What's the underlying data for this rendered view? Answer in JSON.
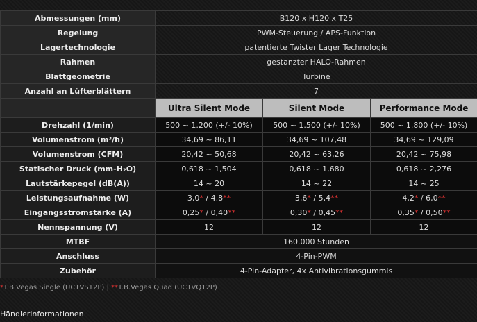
{
  "general": [
    {
      "label": "Abmessungen (mm)",
      "value": "B120 x H120 x T25"
    },
    {
      "label": "Regelung",
      "value": "PWM-Steuerung / APS-Funktion"
    },
    {
      "label": "Lagertechnologie",
      "value": "patentierte Twister Lager Technologie"
    },
    {
      "label": "Rahmen",
      "value": "gestanzter HALO-Rahmen"
    },
    {
      "label": "Blattgeometrie",
      "value": "Turbine"
    },
    {
      "label": "Anzahl an Lüfterblättern",
      "value": "7"
    }
  ],
  "modes": [
    "Ultra Silent Mode",
    "Silent Mode",
    "Performance Mode"
  ],
  "rows": [
    {
      "label": "Drehzahl (1/min)",
      "values": [
        "500 ~ 1.200 (+/- 10%)",
        "500 ~ 1.500 (+/- 10%)",
        "500 ~ 1.800 (+/- 10%)"
      ]
    },
    {
      "label": "Volumenstrom (m³/h)",
      "values": [
        "34,69 ~ 86,11",
        "34,69 ~ 107,48",
        "34,69 ~ 129,09"
      ]
    },
    {
      "label": "Volumenstrom (CFM)",
      "values": [
        "20,42 ~ 50,68",
        "20,42 ~ 63,26",
        "20,42 ~ 75,98"
      ]
    },
    {
      "label": "Statischer Druck (mm-H₂O)",
      "values": [
        "0,618 ~ 1,504",
        "0,618 ~ 1,680",
        "0,618 ~ 2,276"
      ]
    },
    {
      "label": "Lautstärkepegel (dB(A))",
      "values": [
        "14 ~ 20",
        "14 ~ 22",
        "14 ~ 25"
      ]
    }
  ],
  "power": {
    "label": "Leistungsaufnahme (W)",
    "values": [
      {
        "a": "3,0",
        "b": "4,8"
      },
      {
        "a": "3,6",
        "b": "5,4"
      },
      {
        "a": "4,2",
        "b": "6,0"
      }
    ]
  },
  "current": {
    "label": "Eingangsstromstärke (A)",
    "values": [
      {
        "a": "0,25",
        "b": "0,40"
      },
      {
        "a": "0,30",
        "b": "0,45"
      },
      {
        "a": "0,35",
        "b": "0,50"
      }
    ]
  },
  "voltage": {
    "label": "Nennspannung (V)",
    "values": [
      "12",
      "12",
      "12"
    ]
  },
  "footer_rows": [
    {
      "label": "MTBF",
      "value": "160.000 Stunden"
    },
    {
      "label": "Anschluss",
      "value": "4-Pin-PWM"
    },
    {
      "label": "Zubehör",
      "value": "4-Pin-Adapter, 4x Antivibrationsgummis"
    }
  ],
  "marks": {
    "single": "*",
    "double": "**",
    "sep": " / "
  },
  "footnote": {
    "single_text": "T.B.Vegas Single (UCTVS12P)",
    "divider": " | ",
    "quad_text": "T.B.Vegas Quad (UCTVQ12P)"
  },
  "dealer_text": "Händlerinformationen"
}
